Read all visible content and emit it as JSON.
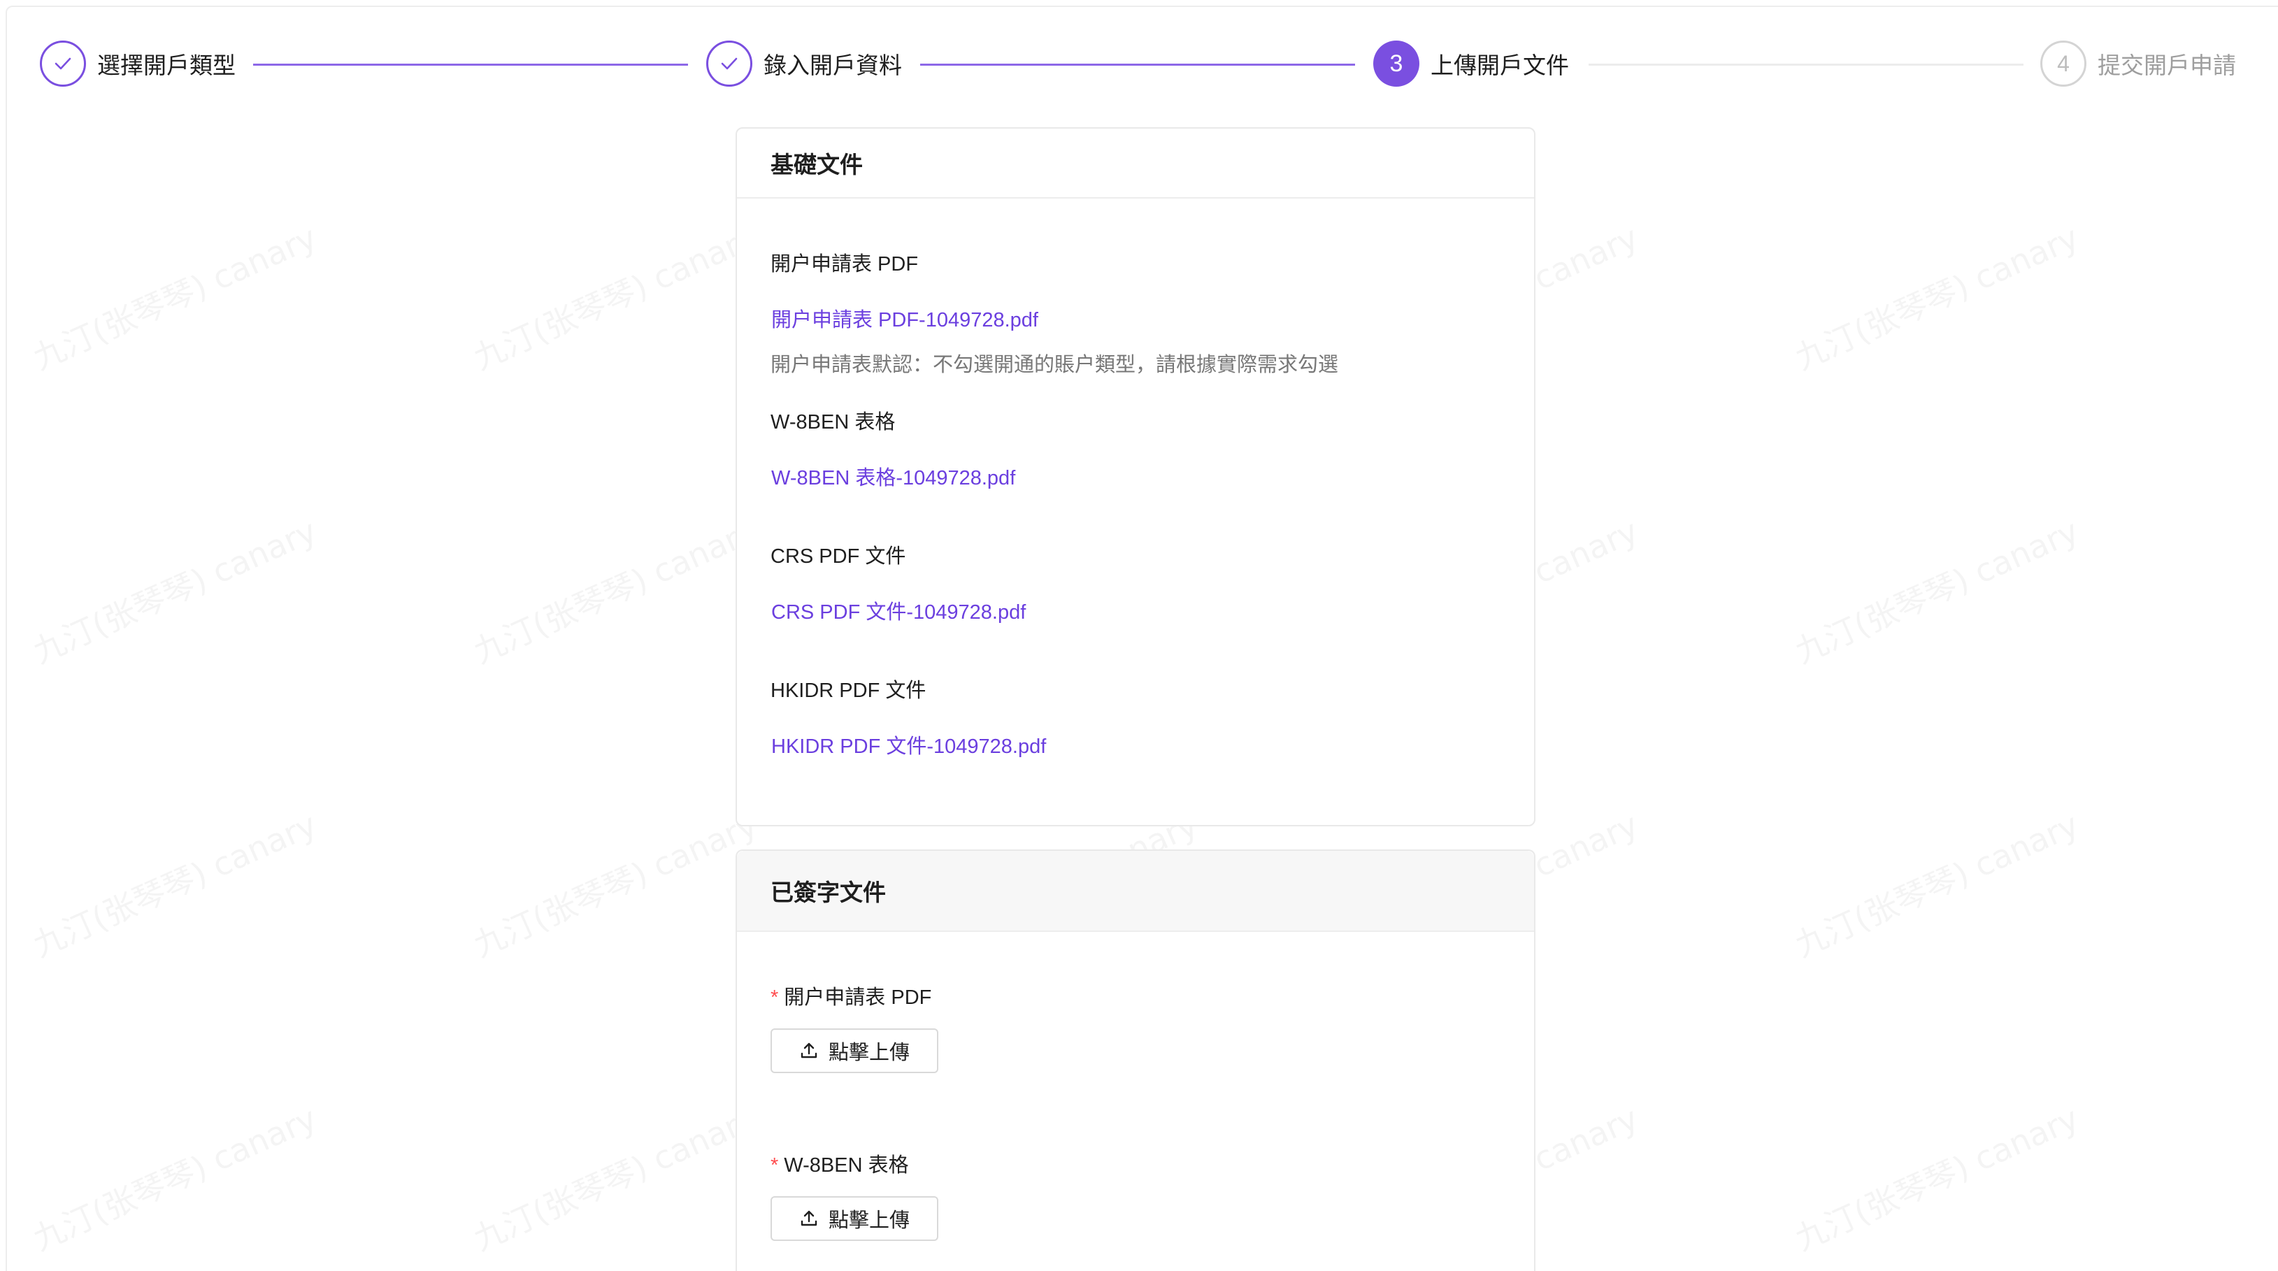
{
  "steps": [
    {
      "label": "選擇開戶類型",
      "status": "done",
      "number": "1"
    },
    {
      "label": "錄入開戶資料",
      "status": "done",
      "number": "2"
    },
    {
      "label": "上傳開戶文件",
      "status": "active",
      "number": "3"
    },
    {
      "label": "提交開戶申請",
      "status": "wait",
      "number": "4"
    }
  ],
  "basic_docs": {
    "title": "基礎文件",
    "items": [
      {
        "label": "開户申請表 PDF",
        "file": "開户申請表 PDF-1049728.pdf",
        "note": "開户申請表默認：不勾選開通的賬户類型，請根據實際需求勾選"
      },
      {
        "label": "W-8BEN 表格",
        "file": "W-8BEN 表格-1049728.pdf"
      },
      {
        "label": "CRS PDF 文件",
        "file": "CRS PDF 文件-1049728.pdf"
      },
      {
        "label": "HKIDR PDF 文件",
        "file": "HKIDR PDF 文件-1049728.pdf"
      }
    ]
  },
  "signed_docs": {
    "title": "已簽字文件",
    "required_mark": "*",
    "upload_label": "點擊上傳",
    "items": [
      {
        "label": "開户申請表 PDF"
      },
      {
        "label": "W-8BEN 表格"
      }
    ]
  },
  "watermark": "九汀(张琴琴) canary",
  "colors": {
    "accent": "#7a4fe0",
    "link": "#6b3fdf",
    "required": "#ff4d4f"
  }
}
